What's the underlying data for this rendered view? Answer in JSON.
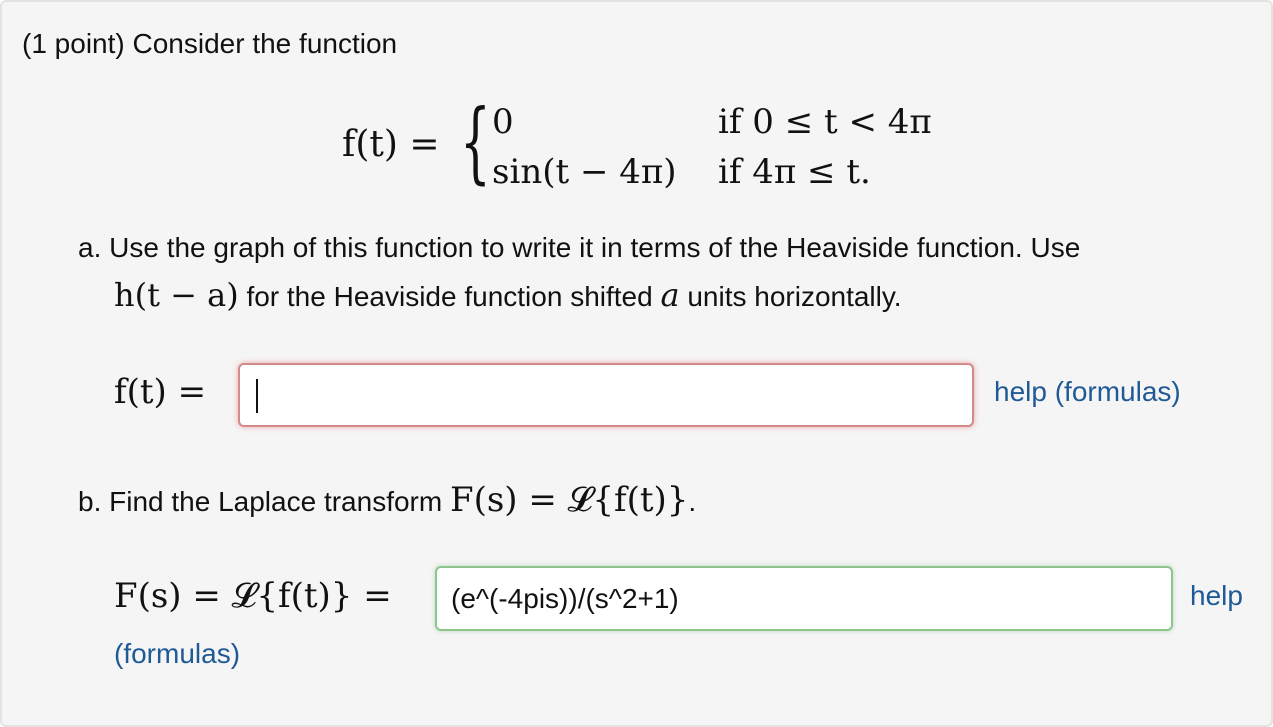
{
  "problem": {
    "intro": "(1 point) Consider the function",
    "piecewise": {
      "lhs": "f(t) =",
      "case1_value": "0",
      "case1_condition": "if 0 ≤ t < 4π",
      "case2_value": "sin(t − 4π)",
      "case2_condition": "if 4π ≤ t."
    },
    "part_a": {
      "line1": "a. Use the graph of this function to write it in terms of the Heaviside function. Use",
      "line2_math": "h(t − a)",
      "line2_text_1": " for the Heaviside function shifted ",
      "line2_math_a": "a",
      "line2_text_2": " units horizontally.",
      "lhs": "f(t) =",
      "input_value": "",
      "help_link": "help (formulas)"
    },
    "part_b": {
      "prefix": "b. Find the Laplace transform ",
      "math": "F(s) = 𝓛{f(t)}",
      "suffix": ".",
      "lhs": "F(s) = 𝓛{f(t)} =",
      "input_value": "(e^(-4pis))/(s^2+1)",
      "help_link_part1": "help",
      "help_link_part2": "(formulas)"
    }
  }
}
